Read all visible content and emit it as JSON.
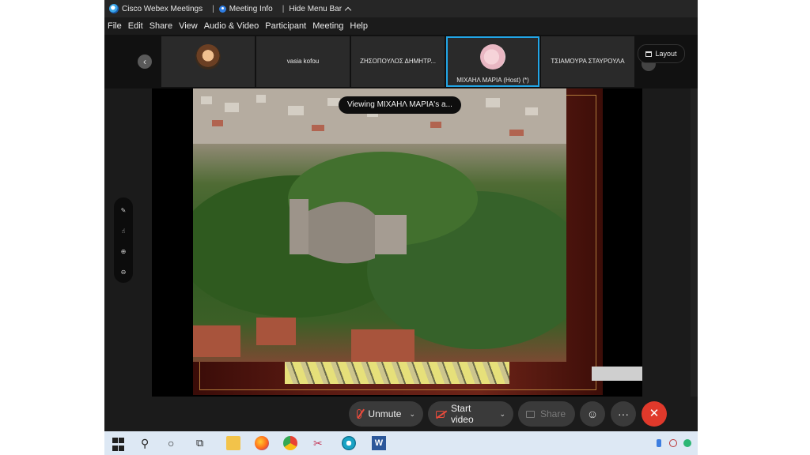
{
  "titlebar": {
    "app_name": "Cisco Webex Meetings",
    "sep1": "|",
    "meeting_info": "Meeting Info",
    "sep2": "|",
    "hide_menu_bar": "Hide Menu Bar"
  },
  "menu": {
    "items": [
      "File",
      "Edit",
      "Share",
      "View",
      "Audio & Video",
      "Participant",
      "Meeting",
      "Help"
    ]
  },
  "participants": [
    {
      "name": "",
      "avatar": "photo-avatar"
    },
    {
      "name": "vasia kofou"
    },
    {
      "name": "ΖΗΣΟΠΟΥΛΟΣ ΔΗΜΗΤΡ..."
    },
    {
      "name": "ΜΙΧΑΗΛ ΜΑΡΙΑ (Host) (*)",
      "avatar": "photo-avatar",
      "active": true
    },
    {
      "name": "ΤΣΙΑΜΟΥΡΑ ΣΤΑΥΡΟΥΛΑ"
    }
  ],
  "layout_button": "Layout",
  "viewing_toast": "Viewing ΜΙΧΑΗΛ ΜΑΡΙΑ's a...",
  "controls": {
    "unmute": "Unmute",
    "start_video": "Start video",
    "share": "Share",
    "more": "···",
    "end": "✕"
  },
  "colors": {
    "active_border": "#22a5e6",
    "mute_red": "#e94b3c",
    "end_red": "#e0392b"
  }
}
